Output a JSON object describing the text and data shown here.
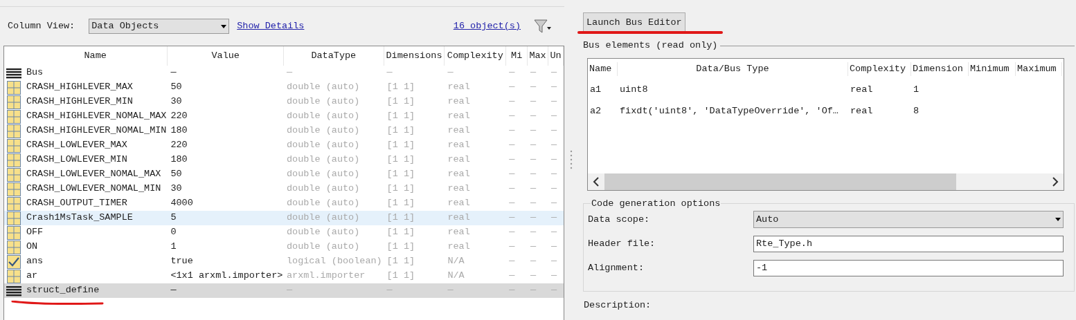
{
  "toolbar": {
    "column_view_label": "Column View:",
    "column_view": "Data Objects",
    "show_details": "Show Details",
    "object_count": "16 object(s)"
  },
  "workspace_table": {
    "columns": [
      "Name",
      "Value",
      "DataType",
      "Dimensions",
      "Complexity",
      "Mi",
      "Max",
      "Un"
    ],
    "rows": [
      {
        "kind": "bus",
        "cells": [
          "Bus",
          "—",
          "—",
          "—",
          "—",
          "—",
          "—",
          "—"
        ],
        "selected": false,
        "hovered": false
      },
      {
        "kind": "variable",
        "cells": [
          "CRASH_HIGHLEVER_MAX",
          "50",
          "double (auto)",
          "[1 1]",
          "real",
          "—",
          "—",
          "—"
        ],
        "selected": false,
        "hovered": false
      },
      {
        "kind": "variable",
        "cells": [
          "CRASH_HIGHLEVER_MIN",
          "30",
          "double (auto)",
          "[1 1]",
          "real",
          "—",
          "—",
          "—"
        ],
        "selected": false,
        "hovered": false
      },
      {
        "kind": "variable",
        "cells": [
          "CRASH_HIGHLEVER_NOMAL_MAX",
          "220",
          "double (auto)",
          "[1 1]",
          "real",
          "—",
          "—",
          "—"
        ],
        "selected": false,
        "hovered": false
      },
      {
        "kind": "variable",
        "cells": [
          "CRASH_HIGHLEVER_NOMAL_MIN",
          "180",
          "double (auto)",
          "[1 1]",
          "real",
          "—",
          "—",
          "—"
        ],
        "selected": false,
        "hovered": false
      },
      {
        "kind": "variable",
        "cells": [
          "CRASH_LOWLEVER_MAX",
          "220",
          "double (auto)",
          "[1 1]",
          "real",
          "—",
          "—",
          "—"
        ],
        "selected": false,
        "hovered": false
      },
      {
        "kind": "variable",
        "cells": [
          "CRASH_LOWLEVER_MIN",
          "180",
          "double (auto)",
          "[1 1]",
          "real",
          "—",
          "—",
          "—"
        ],
        "selected": false,
        "hovered": false
      },
      {
        "kind": "variable",
        "cells": [
          "CRASH_LOWLEVER_NOMAL_MAX",
          "50",
          "double (auto)",
          "[1 1]",
          "real",
          "—",
          "—",
          "—"
        ],
        "selected": false,
        "hovered": false
      },
      {
        "kind": "variable",
        "cells": [
          "CRASH_LOWLEVER_NOMAL_MIN",
          "30",
          "double (auto)",
          "[1 1]",
          "real",
          "—",
          "—",
          "—"
        ],
        "selected": false,
        "hovered": false
      },
      {
        "kind": "variable",
        "cells": [
          "CRASH_OUTPUT_TIMER",
          "4000",
          "double (auto)",
          "[1 1]",
          "real",
          "—",
          "—",
          "—"
        ],
        "selected": false,
        "hovered": false
      },
      {
        "kind": "variable",
        "cells": [
          "Crash1MsTask_SAMPLE",
          "5",
          "double (auto)",
          "[1 1]",
          "real",
          "—",
          "—",
          "—"
        ],
        "selected": false,
        "hovered": true
      },
      {
        "kind": "variable",
        "cells": [
          "OFF",
          "0",
          "double (auto)",
          "[1 1]",
          "real",
          "—",
          "—",
          "—"
        ],
        "selected": false,
        "hovered": false
      },
      {
        "kind": "variable",
        "cells": [
          "ON",
          "1",
          "double (auto)",
          "[1 1]",
          "real",
          "—",
          "—",
          "—"
        ],
        "selected": false,
        "hovered": false
      },
      {
        "kind": "logical",
        "cells": [
          "ans",
          "true",
          "logical (boolean)",
          "[1 1]",
          "N/A",
          "—",
          "—",
          "—"
        ],
        "selected": false,
        "hovered": false
      },
      {
        "kind": "variable",
        "cells": [
          "ar",
          "<1x1 arxml.importer>",
          "arxml.importer",
          "[1 1]",
          "N/A",
          "—",
          "—",
          "—"
        ],
        "selected": false,
        "hovered": false
      },
      {
        "kind": "bus",
        "cells": [
          "struct_define",
          "—",
          "—",
          "—",
          "—",
          "—",
          "—",
          "—"
        ],
        "selected": true,
        "hovered": false
      }
    ]
  },
  "launch_button": "Launch Bus Editor",
  "bus_elements": {
    "title": "Bus elements (read only)",
    "columns": [
      "Name",
      "Data/Bus Type",
      "Complexity",
      "Dimension",
      "Minimum",
      "Maximum"
    ],
    "rows": [
      [
        "a1",
        "uint8",
        "real",
        "1",
        "",
        ""
      ],
      [
        "a2",
        "fixdt('uint8', 'DataTypeOverride', 'Of…",
        "real",
        "8",
        "",
        ""
      ]
    ]
  },
  "code_generation": {
    "title": "Code generation options",
    "data_scope_label": "Data scope:",
    "data_scope": "Auto",
    "header_file_label": "Header file:",
    "header_file": "Rte_Type.h",
    "alignment_label": "Alignment:",
    "alignment": "-1"
  },
  "description_label": "Description:"
}
